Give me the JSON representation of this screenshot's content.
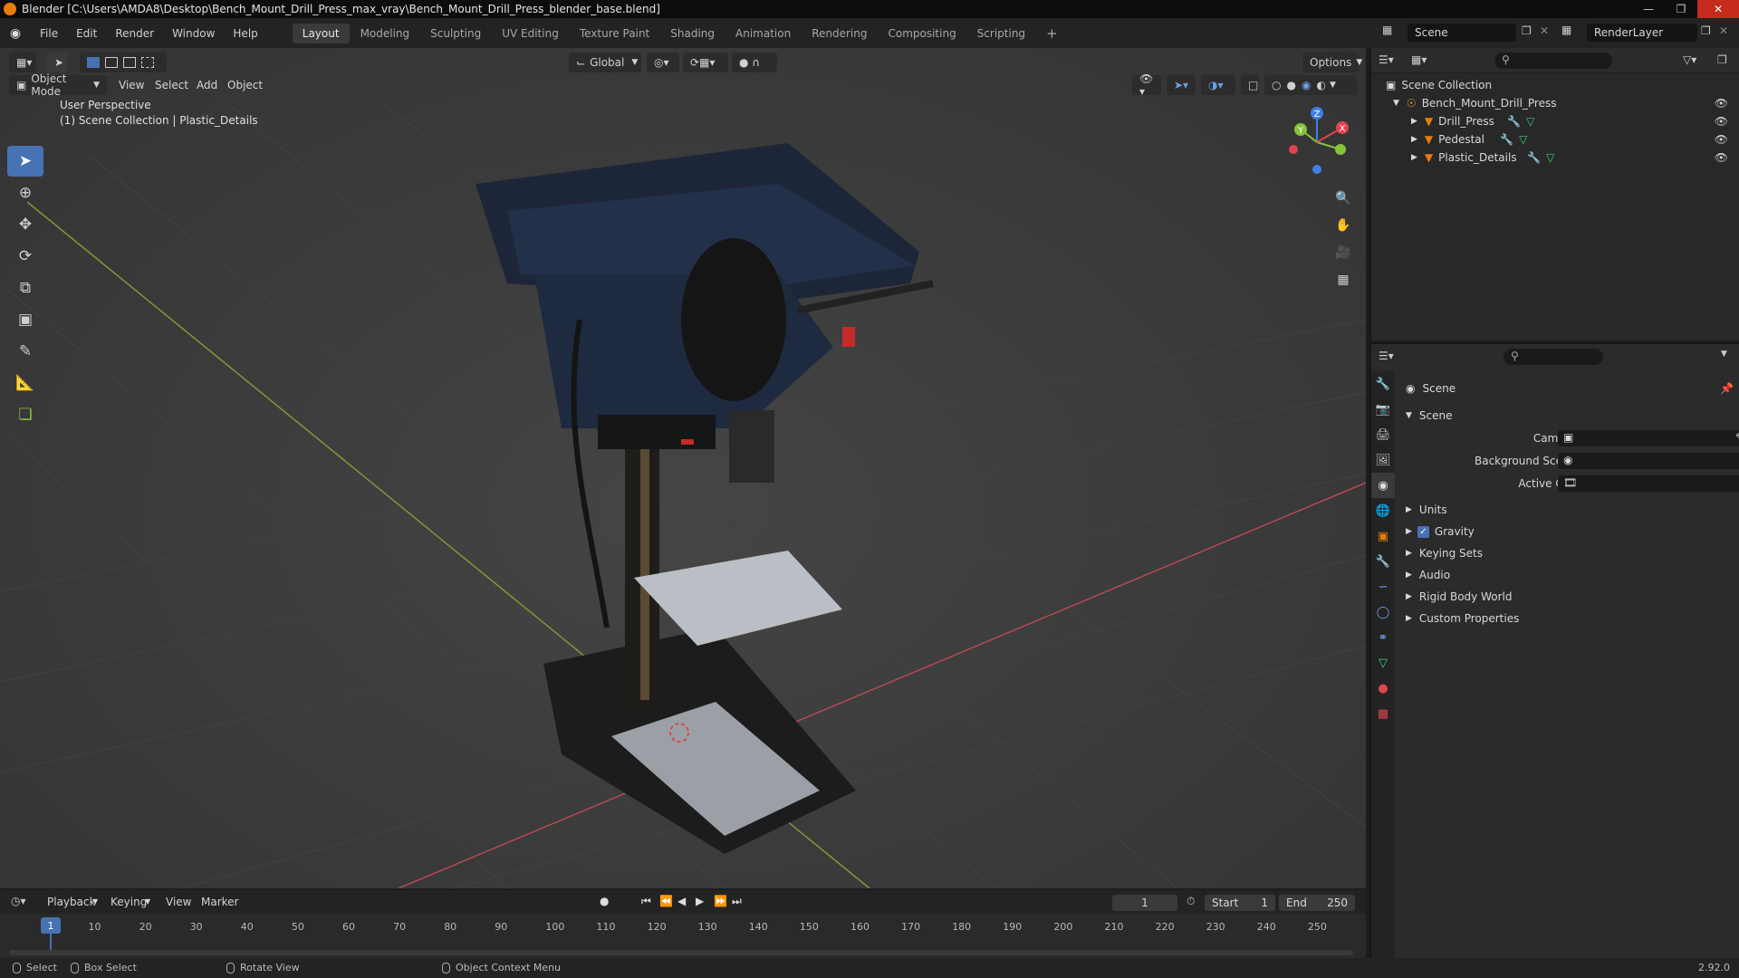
{
  "window": {
    "title": "Blender [C:\\Users\\AMDA8\\Desktop\\Bench_Mount_Drill_Press_max_vray\\Bench_Mount_Drill_Press_blender_base.blend]"
  },
  "menu": [
    "File",
    "Edit",
    "Render",
    "Window",
    "Help"
  ],
  "workspaces": [
    {
      "label": "Layout",
      "active": true
    },
    {
      "label": "Modeling"
    },
    {
      "label": "Sculpting"
    },
    {
      "label": "UV Editing"
    },
    {
      "label": "Texture Paint"
    },
    {
      "label": "Shading"
    },
    {
      "label": "Animation"
    },
    {
      "label": "Rendering"
    },
    {
      "label": "Compositing"
    },
    {
      "label": "Scripting"
    }
  ],
  "scene_selector": {
    "scene": "Scene",
    "view_layer": "RenderLayer"
  },
  "viewport": {
    "transform_orientation": "Global",
    "options_label": "Options",
    "mode": "Object Mode",
    "header_menus": [
      "View",
      "Select",
      "Add",
      "Object"
    ],
    "perspective_label": "User Perspective",
    "collection_label": "(1) Scene Collection | Plastic_Details",
    "gizmo_axes": {
      "x": "X",
      "y": "Y",
      "z": "Z"
    }
  },
  "outliner": {
    "root": "Scene Collection",
    "collection": "Bench_Mount_Drill_Press",
    "objects": [
      "Drill_Press",
      "Pedestal",
      "Plastic_Details"
    ]
  },
  "properties": {
    "header": "Scene",
    "panel": "Scene",
    "fields": [
      {
        "label": "Camera"
      },
      {
        "label": "Background Scene"
      },
      {
        "label": "Active Clip"
      }
    ],
    "sections": [
      "Units",
      "Gravity",
      "Keying Sets",
      "Audio",
      "Rigid Body World",
      "Custom Properties"
    ],
    "gravity_checked": true
  },
  "timeline": {
    "menus": [
      "Playback",
      "Keying",
      "View",
      "Marker"
    ],
    "current_frame": "1",
    "start_label": "Start",
    "start": "1",
    "end_label": "End",
    "end": "250",
    "ticks": [
      "1",
      "10",
      "20",
      "30",
      "40",
      "50",
      "60",
      "70",
      "80",
      "90",
      "100",
      "110",
      "120",
      "130",
      "140",
      "150",
      "160",
      "170",
      "180",
      "190",
      "200",
      "210",
      "220",
      "230",
      "240",
      "250"
    ]
  },
  "statusbar": {
    "select": "Select",
    "box_select": "Box Select",
    "rotate_view": "Rotate View",
    "context_menu": "Object Context Menu",
    "version": "2.92.0"
  },
  "colors": {
    "accent": "#4772b3",
    "x_axis": "#e04452",
    "y_axis": "#86c43a",
    "z_axis": "#3f7fe6",
    "object_orange": "#e87d0d"
  }
}
